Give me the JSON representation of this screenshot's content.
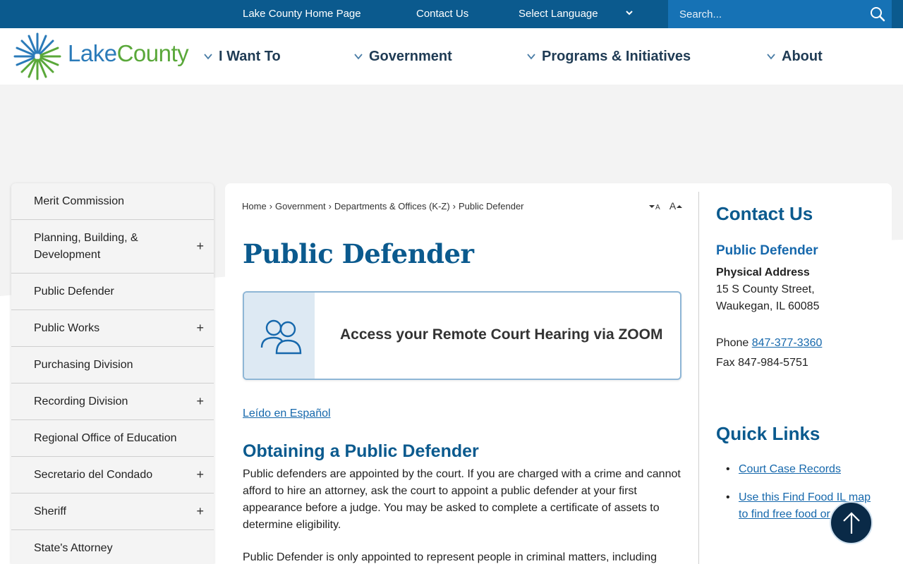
{
  "topbar": {
    "home_link": "Lake County Home Page",
    "contact_link": "Contact Us",
    "language_label": "Select Language",
    "search_placeholder": "Search..."
  },
  "logo": {
    "part1": "Lake",
    "part2": "County"
  },
  "nav": [
    {
      "label": "I Want To"
    },
    {
      "label": "Government"
    },
    {
      "label": "Programs & Initiatives"
    },
    {
      "label": "About"
    }
  ],
  "sidebar": {
    "items": [
      {
        "label": "Merit Commission",
        "expandable": false
      },
      {
        "label": "Planning, Building, & Development",
        "expandable": true
      },
      {
        "label": "Public Defender",
        "expandable": false
      },
      {
        "label": "Public Works",
        "expandable": true
      },
      {
        "label": "Purchasing Division",
        "expandable": false
      },
      {
        "label": "Recording Division",
        "expandable": true
      },
      {
        "label": "Regional Office of Education",
        "expandable": false
      },
      {
        "label": "Secretario del Condado",
        "expandable": true
      },
      {
        "label": "Sheriff",
        "expandable": true
      },
      {
        "label": "State's Attorney",
        "expandable": false
      }
    ],
    "plus": "+"
  },
  "breadcrumb": [
    "Home",
    "Government",
    "Departments & Offices (K-Z)",
    "Public Defender"
  ],
  "breadcrumb_sep": "›",
  "font_resize": {
    "smaller": "A",
    "larger": "A"
  },
  "page_title": "Public Defender",
  "zoom_banner": {
    "label": "Access your Remote Court Hearing via ZOOM"
  },
  "spanish_link": "Leído en Español",
  "section": {
    "heading": "Obtaining a Public Defender",
    "para1": "Public defenders are appointed by the court. If you are charged with a crime and cannot afford to hire an attorney, ask the court to appoint a public defender at your first appearance before a judge. You may be asked to complete a certificate of assets to determine eligibility.",
    "para2": "Public Defender is only appointed to represent people in criminal matters, including"
  },
  "contact": {
    "heading": "Contact Us",
    "office": "Public Defender",
    "address_label": "Physical Address",
    "address_line1": "15 S County Street,",
    "address_line2": "Waukegan, IL 60085",
    "phone_label": "Phone",
    "phone": "847-377-3360",
    "fax": "Fax 847-984-5751"
  },
  "quick_links": {
    "heading": "Quick Links",
    "items": [
      {
        "label": "Court Case Records"
      },
      {
        "label": "Use this Find Food IL map to find free food or"
      }
    ]
  },
  "colors": {
    "topbar": "#0b5a8e",
    "search_bg": "#1672b5",
    "heading_blue": "#0b5a8e",
    "link_blue": "#1668ac",
    "logo_green": "#5aa83a",
    "totop_bg": "#0a2a47"
  },
  "icons": [
    "search-icon",
    "chevron-down-icon",
    "users-icon",
    "arrow-up-icon",
    "logo-star-icon"
  ]
}
